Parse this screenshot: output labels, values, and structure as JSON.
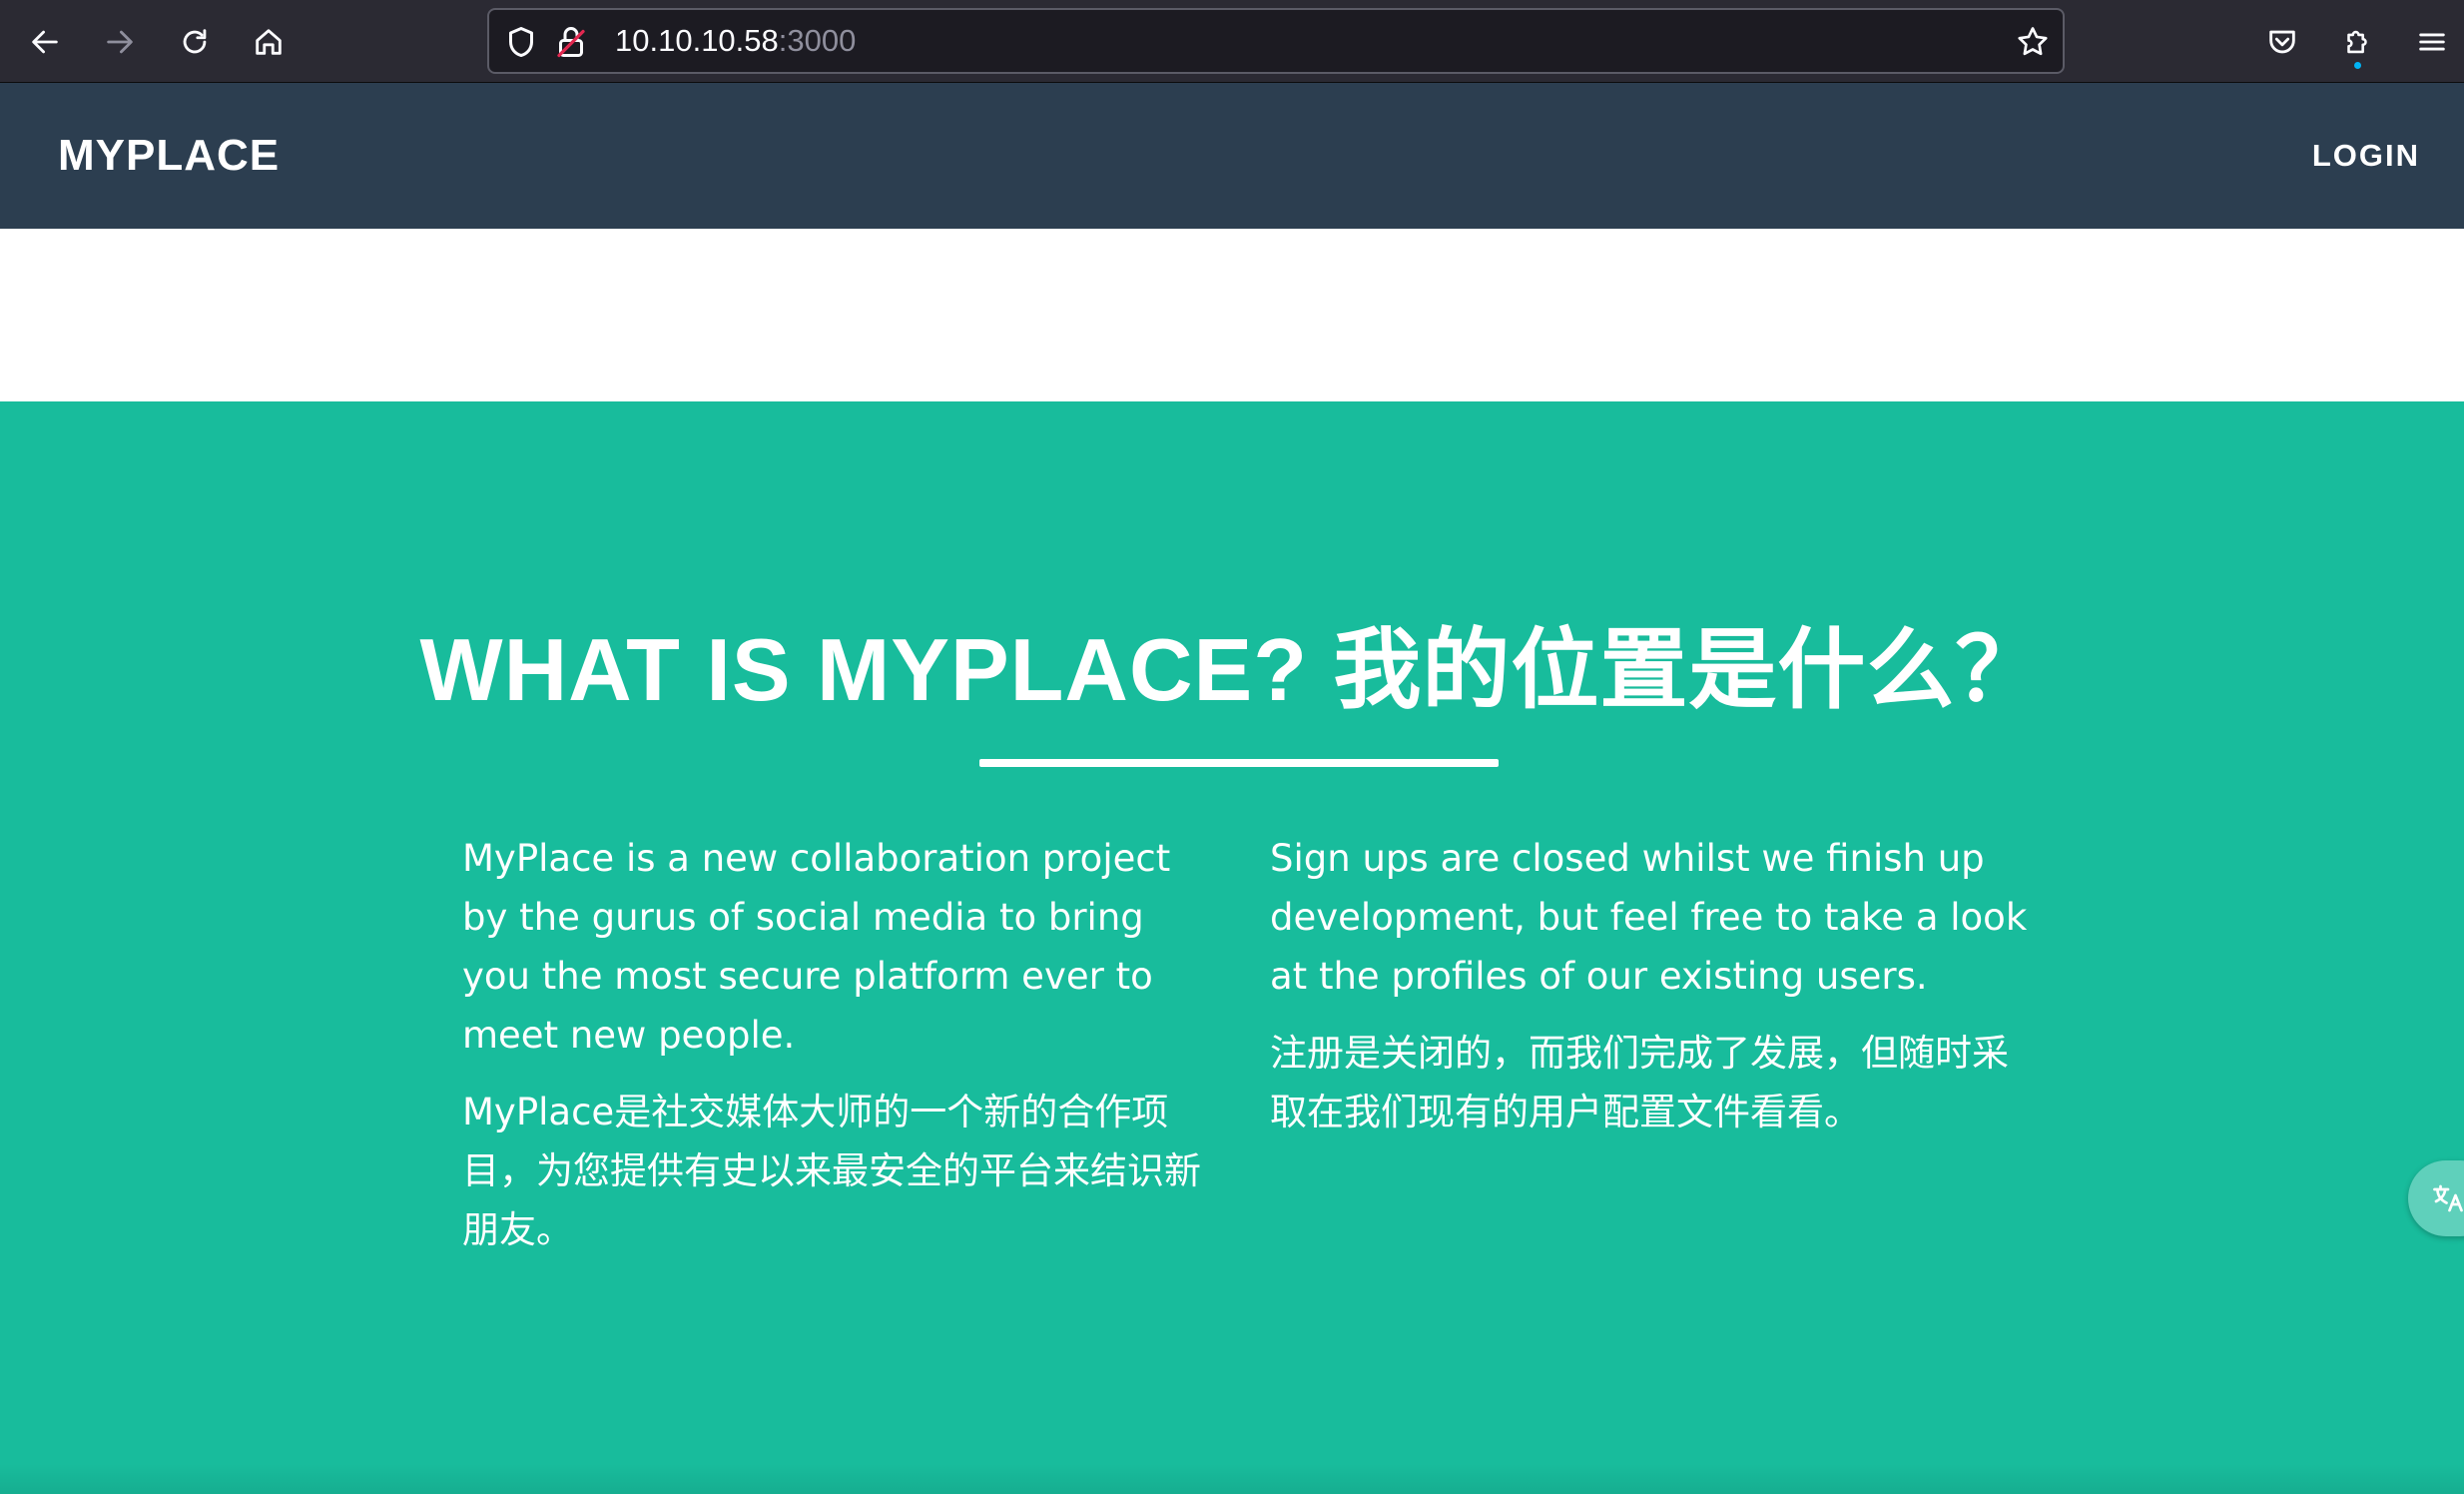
{
  "browser": {
    "url_host": "10.10.10.58",
    "url_port": ":3000",
    "icons": {
      "back": "arrow-left-icon",
      "forward": "arrow-right-icon",
      "reload": "reload-icon",
      "home": "home-icon",
      "shield": "shield-icon",
      "lock": "insecure-lock-icon",
      "bookmark": "star-icon",
      "pocket": "pocket-icon",
      "extensions": "puzzle-icon",
      "menu": "hamburger-menu-icon"
    }
  },
  "navbar": {
    "brand": "MYPLACE",
    "login": "LOGIN"
  },
  "about": {
    "title": "WHAT IS MYPLACE? 我的位置是什么？",
    "left": {
      "en": "MyPlace is a new collaboration project by the gurus of social media to bring you the most secure platform ever to meet new people.",
      "zh": "MyPlace是社交媒体大师的一个新的合作项目，为您提供有史以来最安全的平台来结识新朋友。"
    },
    "right": {
      "en": "Sign ups are closed whilst we finish up development, but feel free to take a look at the profiles of our existing users.",
      "zh": "注册是关闭的，而我们完成了发展，但随时采取在我们现有的用户配置文件看看。"
    }
  },
  "colors": {
    "chrome": "#2b2a33",
    "navbar": "#2c3e50",
    "accent": "#18bc9c",
    "text_light": "#ffffff"
  }
}
